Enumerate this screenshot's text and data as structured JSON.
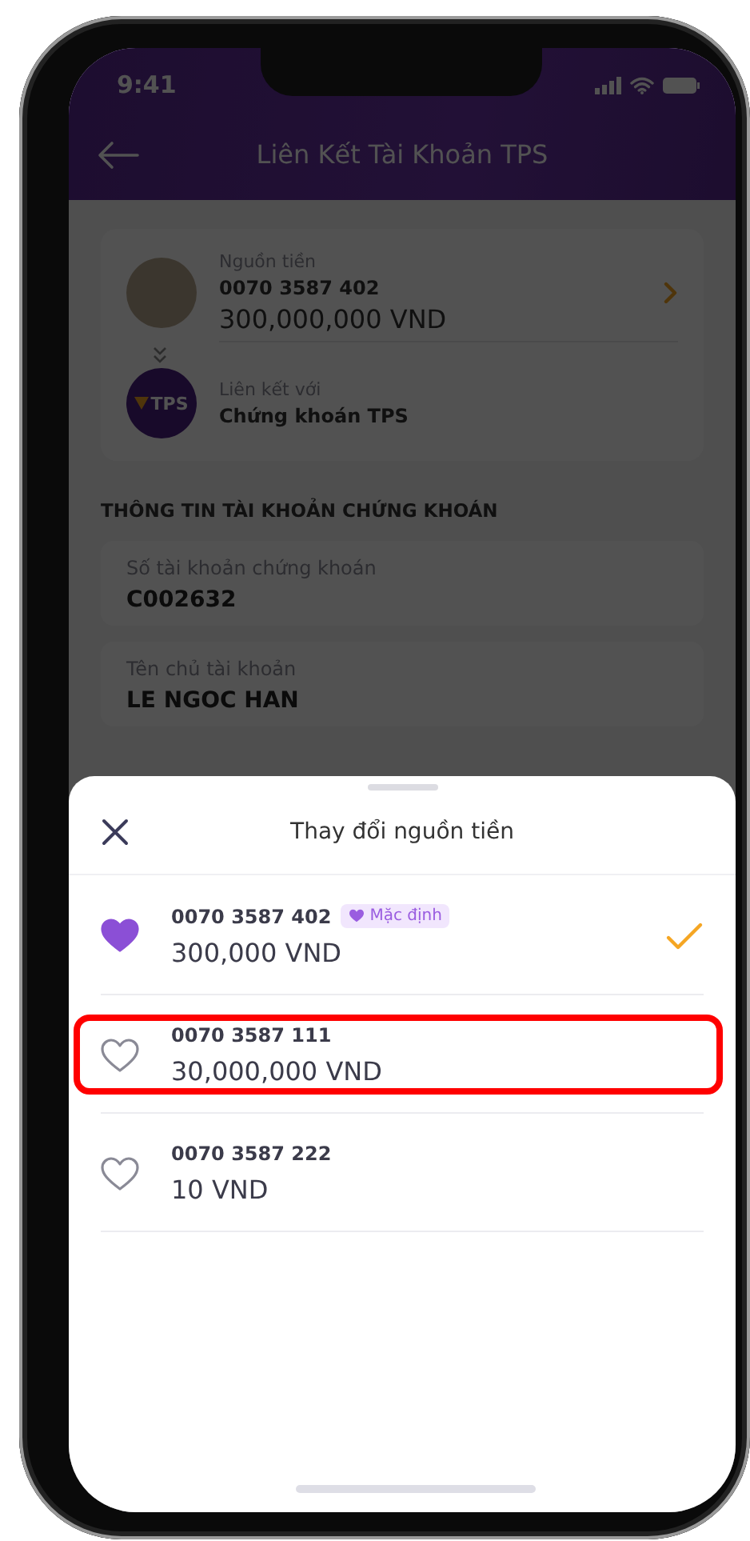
{
  "status_bar": {
    "time": "9:41"
  },
  "header": {
    "title": "Liên Kết Tài Khoản TPS"
  },
  "source_card": {
    "source_label": "Nguồn tiền",
    "account_number": "0070 3587 402",
    "balance": "300,000,000 VND",
    "link_label": "Liên kết với",
    "link_target": "Chứng khoán TPS",
    "logo_text": "TPS"
  },
  "section_title": "THÔNG TIN TÀI KHOẢN CHỨNG KHOÁN",
  "fields": [
    {
      "label": "Số tài khoản chứng khoán",
      "value": "C002632"
    },
    {
      "label": "Tên chủ tài khoản",
      "value": "LE NGOC HAN"
    }
  ],
  "sheet": {
    "title": "Thay đổi nguồn tiền",
    "accounts": [
      {
        "number": "0070 3587 402",
        "badge": "Mặc định",
        "balance": "300,000 VND",
        "favorite": true,
        "selected": true,
        "highlighted": false
      },
      {
        "number": "0070 3587 111",
        "balance": "30,000,000 VND",
        "favorite": false,
        "selected": false,
        "highlighted": true
      },
      {
        "number": "0070 3587 222",
        "balance": "10 VND",
        "favorite": false,
        "selected": false,
        "highlighted": false
      }
    ]
  }
}
